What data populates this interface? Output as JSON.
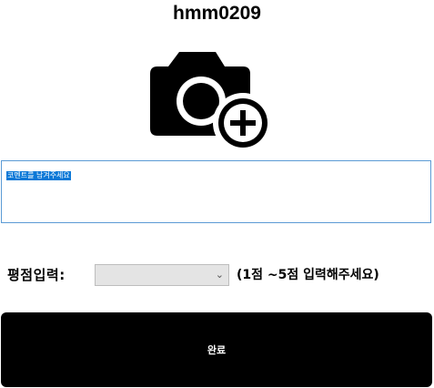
{
  "header": {
    "username": "hmm0209"
  },
  "photo": {
    "icon": "camera-add-icon"
  },
  "comment": {
    "value": "코멘트를 남겨주세요"
  },
  "rating": {
    "label": "평점입력:",
    "selected_value": "",
    "hint": "(1점 ~5점 입력해주세요)"
  },
  "submit": {
    "label": "완료"
  },
  "colors": {
    "comment_border": "#5b9bd5",
    "selection_highlight": "#0a78d7",
    "select_background": "#e4e4e4",
    "button_background": "#000000"
  }
}
